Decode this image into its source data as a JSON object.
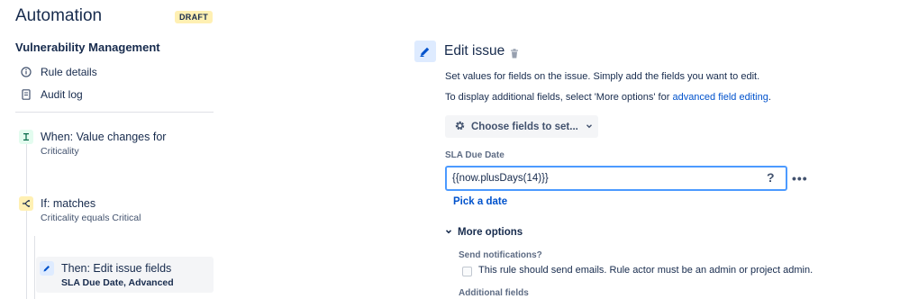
{
  "app": {
    "title": "Automation",
    "badge": "DRAFT"
  },
  "sidebar": {
    "rule_name": "Vulnerability Management",
    "links": [
      {
        "label": "Rule details",
        "icon": "info-icon"
      },
      {
        "label": "Audit log",
        "icon": "document-icon"
      }
    ],
    "steps": [
      {
        "title": "When: Value changes for",
        "subtitle": "Criticality",
        "icon": "trigger-icon",
        "color": "#e3fcef"
      },
      {
        "title": "If: matches",
        "subtitle": "Criticality equals Critical",
        "icon": "condition-icon",
        "color": "#fff0b3"
      },
      {
        "title": "Then: Edit issue fields",
        "subtitle": "SLA Due Date, Advanced",
        "icon": "pencil-icon",
        "color": "#deebff"
      }
    ]
  },
  "editor": {
    "title": "Edit issue",
    "description_1": "Set values for fields on the issue. Simply add the fields you want to edit.",
    "description_2_prefix": "To display additional fields, select 'More options' for ",
    "description_2_link": "advanced field editing",
    "description_2_suffix": ".",
    "choose_fields_label": "Choose fields to set...",
    "field": {
      "label": "SLA Due Date",
      "value": "{{now.plusDays(14)}}",
      "help": "?",
      "more": "•••",
      "pick_date": "Pick a date"
    },
    "more_options": {
      "label": "More options",
      "send_notifications_label": "Send notifications?",
      "send_emails_text": "This rule should send emails. Rule actor must be an admin or project admin.",
      "send_emails_checked": false,
      "additional_fields_label": "Additional fields"
    }
  },
  "colors": {
    "accent": "#0052cc",
    "focus": "#4c9aff"
  }
}
